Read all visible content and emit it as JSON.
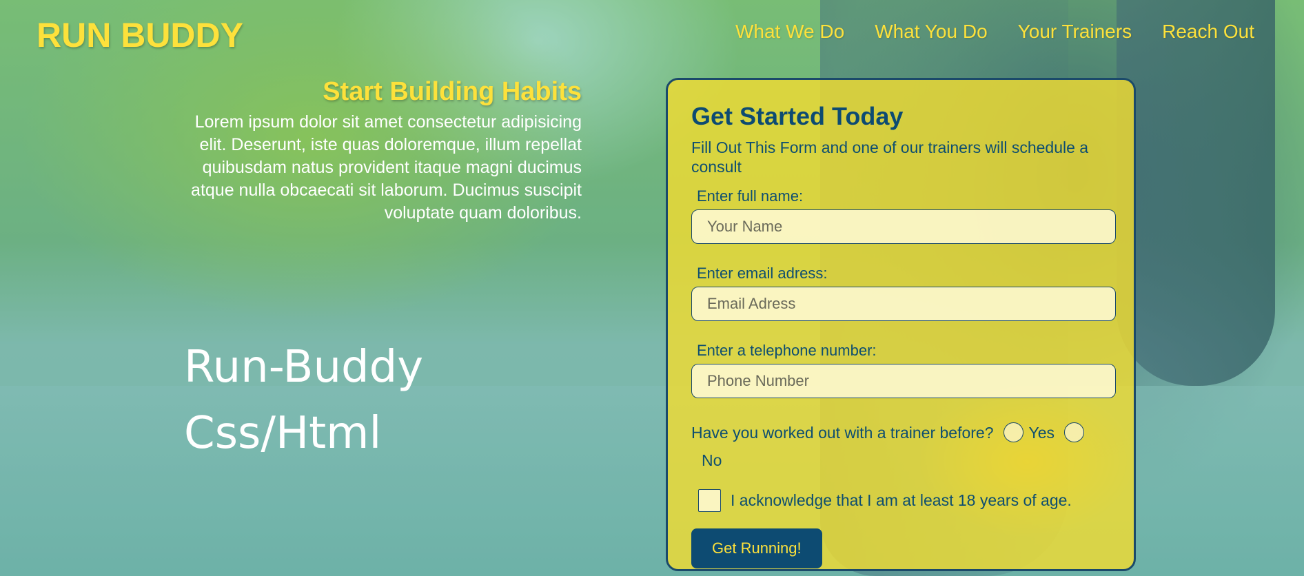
{
  "header": {
    "logo": "RUN BUDDY",
    "nav": [
      "What We Do",
      "What You Do",
      "Your Trainers",
      "Reach Out"
    ]
  },
  "hero": {
    "title": "Start Building Habits",
    "text": "Lorem ipsum dolor sit amet consectetur adipisicing elit. Deserunt, iste quas doloremque, illum repellat quibusdam natus provident itaque magni ducimus atque nulla obcaecati sit laborum. Ducimus suscipit voluptate quam doloribus."
  },
  "watermark": {
    "line1": "Run-Buddy",
    "line2": "Css/Html"
  },
  "form": {
    "title": "Get Started Today",
    "subtitle": "Fill Out This Form and one of our trainers will schedule a consult",
    "name_label": "Enter full name:",
    "name_placeholder": "Your Name",
    "email_label": "Enter email adress:",
    "email_placeholder": "Email Adress",
    "phone_label": "Enter a telephone number:",
    "phone_placeholder": "Phone Number",
    "trainer_question": "Have you worked out with a trainer before?",
    "yes_label": "Yes",
    "no_label": "No",
    "age_ack": "I acknowledge that I am at least 18 years of age.",
    "submit_label": "Get Running!"
  },
  "colors": {
    "accent": "#fde13b",
    "primary": "#0d4b72"
  }
}
